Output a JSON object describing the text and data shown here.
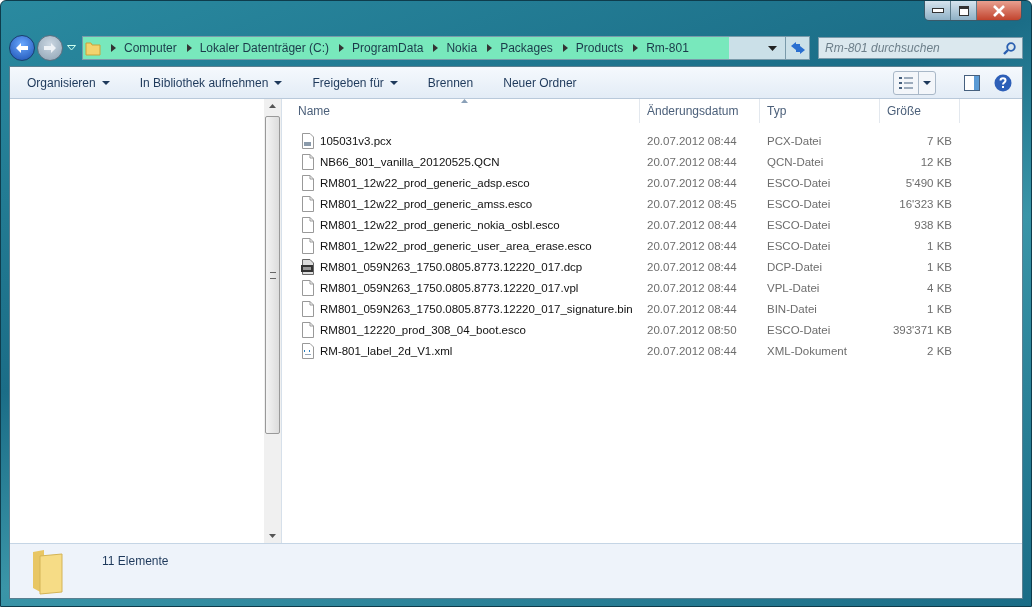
{
  "address_bar": {
    "segments": [
      "Computer",
      "Lokaler Datenträger (C:)",
      "ProgramData",
      "Nokia",
      "Packages",
      "Products",
      "Rm-801"
    ]
  },
  "search": {
    "placeholder": "Rm-801 durchsuchen"
  },
  "toolbar": [
    {
      "label": "Organisieren",
      "has_menu": true
    },
    {
      "label": "In Bibliothek aufnehmen",
      "has_menu": true
    },
    {
      "label": "Freigeben für",
      "has_menu": true
    },
    {
      "label": "Brennen",
      "has_menu": false
    },
    {
      "label": "Neuer Ordner",
      "has_menu": false
    }
  ],
  "table": {
    "columns": [
      {
        "label": "Name",
        "sorted": true
      },
      {
        "label": "Änderungsdatum",
        "sorted": false
      },
      {
        "label": "Typ",
        "sorted": false
      },
      {
        "label": "Größe",
        "sorted": false
      }
    ],
    "rows": [
      {
        "kind": "pcx",
        "name": "105031v3.pcx",
        "date": "20.07.2012 08:44",
        "type": "PCX-Datei",
        "size": "7 KB"
      },
      {
        "kind": "blank",
        "name": "NB66_801_vanilla_20120525.QCN",
        "date": "20.07.2012 08:44",
        "type": "QCN-Datei",
        "size": "12 KB"
      },
      {
        "kind": "blank",
        "name": "RM801_12w22_prod_generic_adsp.esco",
        "date": "20.07.2012 08:44",
        "type": "ESCO-Datei",
        "size": "5'490 KB"
      },
      {
        "kind": "blank",
        "name": "RM801_12w22_prod_generic_amss.esco",
        "date": "20.07.2012 08:45",
        "type": "ESCO-Datei",
        "size": "16'323 KB"
      },
      {
        "kind": "blank",
        "name": "RM801_12w22_prod_generic_nokia_osbl.esco",
        "date": "20.07.2012 08:44",
        "type": "ESCO-Datei",
        "size": "938 KB"
      },
      {
        "kind": "blank",
        "name": "RM801_12w22_prod_generic_user_area_erase.esco",
        "date": "20.07.2012 08:44",
        "type": "ESCO-Datei",
        "size": "1 KB"
      },
      {
        "kind": "dcp",
        "name": "RM801_059N263_1750.0805.8773.12220_017.dcp",
        "date": "20.07.2012 08:44",
        "type": "DCP-Datei",
        "size": "1 KB"
      },
      {
        "kind": "blank",
        "name": "RM801_059N263_1750.0805.8773.12220_017.vpl",
        "date": "20.07.2012 08:44",
        "type": "VPL-Datei",
        "size": "4 KB"
      },
      {
        "kind": "blank",
        "name": "RM801_059N263_1750.0805.8773.12220_017_signature.bin",
        "date": "20.07.2012 08:44",
        "type": "BIN-Datei",
        "size": "1 KB"
      },
      {
        "kind": "blank",
        "name": "RM801_12220_prod_308_04_boot.esco",
        "date": "20.07.2012 08:50",
        "type": "ESCO-Datei",
        "size": "393'371 KB"
      },
      {
        "kind": "xml",
        "name": "RM-801_label_2d_V1.xml",
        "date": "20.07.2012 08:44",
        "type": "XML-Dokument",
        "size": "2 KB"
      }
    ]
  },
  "status_bar": {
    "text": "11 Elemente"
  }
}
